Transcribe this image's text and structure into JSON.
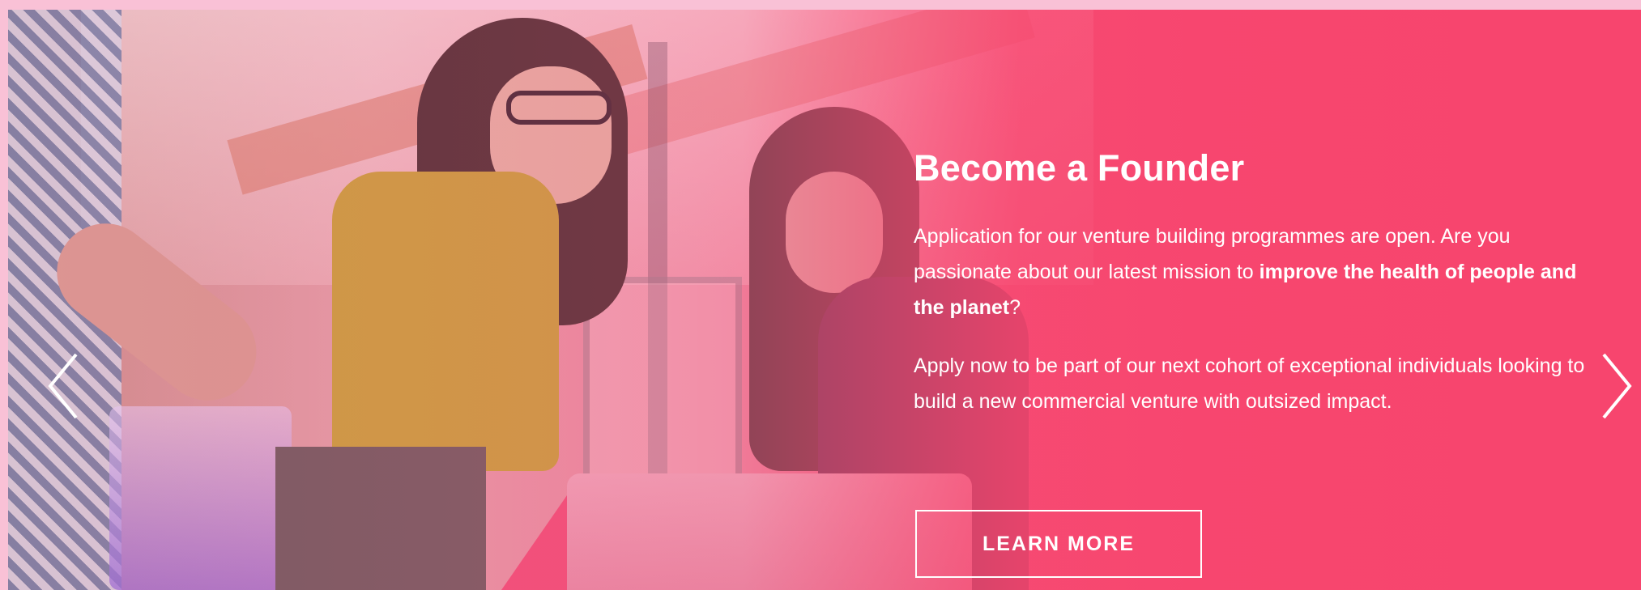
{
  "slide": {
    "title": "Become a Founder",
    "paragraph1_part1": "Application for our venture building programmes are open. Are you passionate about our latest mission to ",
    "paragraph1_bold": "improve the health of people and the planet",
    "paragraph1_part2": "?",
    "paragraph2": "Apply now to be part of our next cohort of exceptional individuals looking to build a new commercial venture with outsized impact.",
    "cta_label": "LEARN MORE"
  },
  "carousel": {
    "prev_icon": "chevron-left-icon",
    "next_icon": "chevron-right-icon"
  },
  "colors": {
    "accent": "#f7456e",
    "text": "#ffffff"
  }
}
